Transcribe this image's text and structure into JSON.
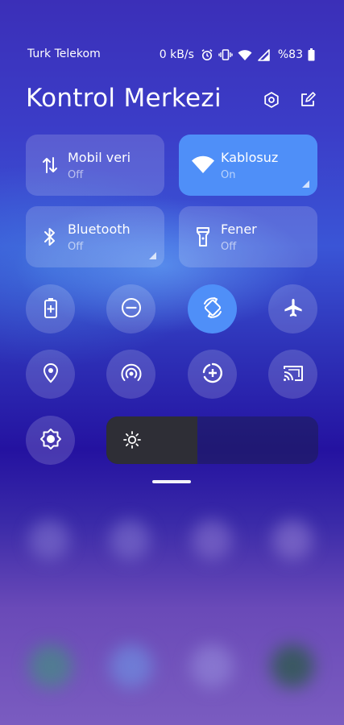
{
  "status_bar": {
    "carrier": "Turk Telekom",
    "speed": "0 kB/s",
    "battery": "%83"
  },
  "header": {
    "title": "Kontrol Merkezi"
  },
  "tiles": [
    {
      "name": "Mobil veri",
      "state": "Off",
      "active": false,
      "icon": "mobile-data-icon"
    },
    {
      "name": "Kablosuz",
      "state": "On",
      "active": true,
      "icon": "wifi-icon"
    },
    {
      "name": "Bluetooth",
      "state": "Off",
      "active": false,
      "icon": "bluetooth-icon"
    },
    {
      "name": "Fener",
      "state": "Off",
      "active": false,
      "icon": "flashlight-icon"
    }
  ],
  "toggles": [
    {
      "icon": "battery-saver-icon",
      "active": false
    },
    {
      "icon": "do-not-disturb-icon",
      "active": false
    },
    {
      "icon": "auto-rotate-icon",
      "active": true
    },
    {
      "icon": "airplane-icon",
      "active": false
    },
    {
      "icon": "location-icon",
      "active": false
    },
    {
      "icon": "hotspot-icon",
      "active": false
    },
    {
      "icon": "data-saver-icon",
      "active": false
    },
    {
      "icon": "cast-icon",
      "active": false
    },
    {
      "icon": "adaptive-brightness-icon",
      "active": false
    }
  ],
  "brightness": {
    "level": 0.43
  },
  "colors": {
    "accent": "#4f8ff8",
    "tile_bg": "rgba(255,255,255,0.16)"
  }
}
